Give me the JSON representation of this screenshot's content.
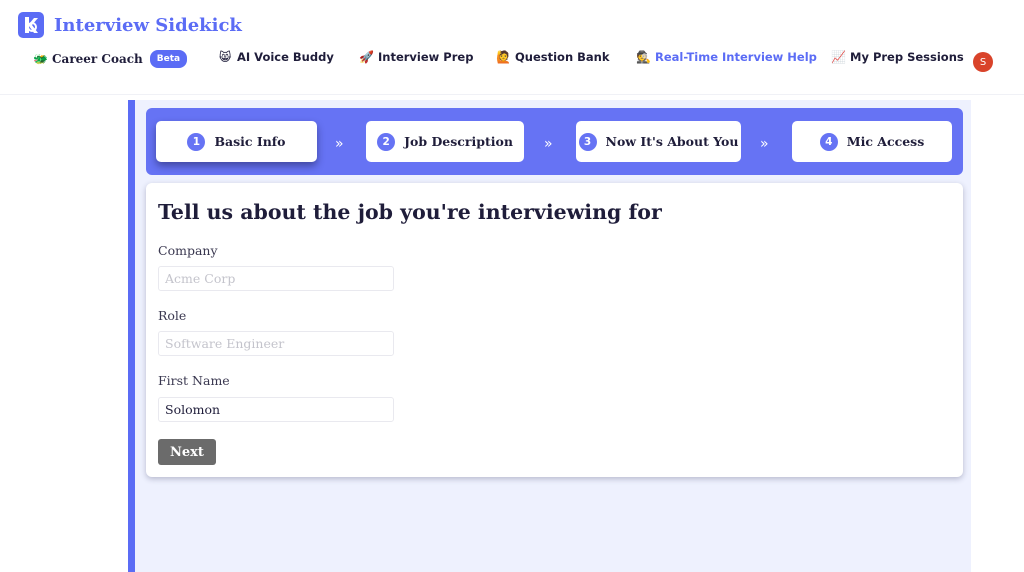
{
  "app": {
    "name": "Interview Sidekick"
  },
  "nav": {
    "items": [
      {
        "label": "Career Coach",
        "icon": "🐲",
        "badge": "Beta"
      },
      {
        "label": "AI Voice Buddy",
        "icon": "😸"
      },
      {
        "label": "Interview Prep",
        "icon": "🚀"
      },
      {
        "label": "Question Bank",
        "icon": "🙋"
      },
      {
        "label": "Real-Time Interview Help",
        "icon": "🕵",
        "active": true
      },
      {
        "label": "My Prep Sessions",
        "icon": "📈"
      }
    ],
    "avatar_initial": "S"
  },
  "stepper": {
    "steps": [
      {
        "num": "1",
        "label": "Basic Info",
        "current": true
      },
      {
        "num": "2",
        "label": "Job Description"
      },
      {
        "num": "3",
        "label": "Now It's About You"
      },
      {
        "num": "4",
        "label": "Mic Access"
      }
    ],
    "separator": "»"
  },
  "form": {
    "title": "Tell us about the job you're interviewing for",
    "fields": [
      {
        "label": "Company",
        "value": "",
        "placeholder": "Acme Corp"
      },
      {
        "label": "Role",
        "value": "",
        "placeholder": "Software Engineer"
      },
      {
        "label": "First Name",
        "value": "Solomon",
        "placeholder": ""
      }
    ],
    "next_label": "Next"
  },
  "colors": {
    "accent": "#5b6cf5",
    "stepper_bg": "#6673f4",
    "panel_bg": "#eef1fe",
    "button_bg": "#6b6b6b",
    "avatar_bg": "#d9432a"
  }
}
